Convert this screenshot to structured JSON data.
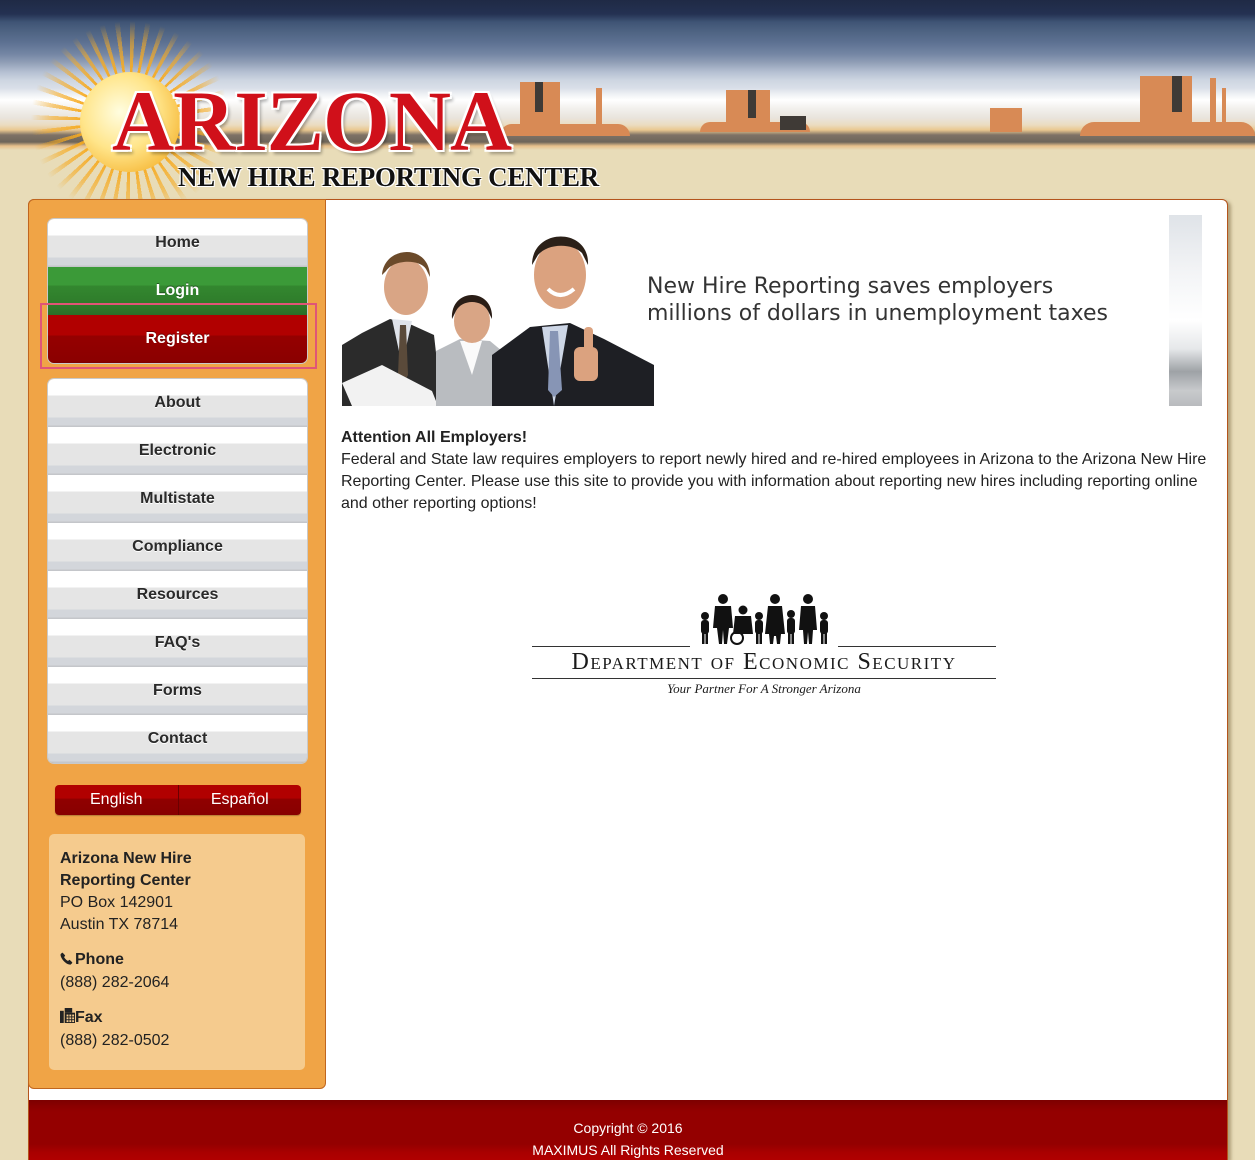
{
  "header": {
    "title": "ARIZONA",
    "subtitle": "NEW HIRE REPORTING CENTER"
  },
  "sidebar": {
    "primary_nav": [
      {
        "label": "Home",
        "style": "default"
      },
      {
        "label": "Login",
        "style": "green"
      },
      {
        "label": "Register",
        "style": "red",
        "highlighted": true
      }
    ],
    "secondary_nav": [
      {
        "label": "About"
      },
      {
        "label": "Electronic"
      },
      {
        "label": "Multistate"
      },
      {
        "label": "Compliance"
      },
      {
        "label": "Resources"
      },
      {
        "label": "FAQ's"
      },
      {
        "label": "Forms"
      },
      {
        "label": "Contact"
      }
    ],
    "languages": [
      {
        "label": "English"
      },
      {
        "label": "Español"
      }
    ],
    "contact": {
      "org_line1": "Arizona New Hire",
      "org_line2": "Reporting Center",
      "address_line1": "PO Box 142901",
      "address_line2": "Austin TX 78714",
      "phone_label": "Phone",
      "phone_icon": "phone-icon",
      "phone": "(888) 282-2064",
      "fax_label": "Fax",
      "fax_icon": "fax-icon",
      "fax": "(888) 282-0502"
    }
  },
  "main": {
    "banner": {
      "line1": "New Hire Reporting saves employers",
      "line2": "millions of dollars in unemployment taxes"
    },
    "notice": {
      "heading": "Attention All Employers!",
      "body": "Federal and State law requires employers to report newly hired and re-hired employees in Arizona to the Arizona New Hire Reporting Center. Please use this site to provide you with information about reporting new hires including reporting online and other reporting options!"
    },
    "des_logo": {
      "title": "Department of Economic Security",
      "tagline": "Your Partner For A Stronger Arizona"
    }
  },
  "footer": {
    "copyright": "Copyright © 2016",
    "rights": "MAXIMUS All Rights Reserved"
  },
  "colors": {
    "sidebar_bg": "#f0a446",
    "contact_bg": "#f5cb8e",
    "login_green": "#3b9a38",
    "register_red": "#b10000",
    "footer_red": "#940000",
    "page_bg": "#e8dcb8",
    "title_red": "#d0101a"
  }
}
